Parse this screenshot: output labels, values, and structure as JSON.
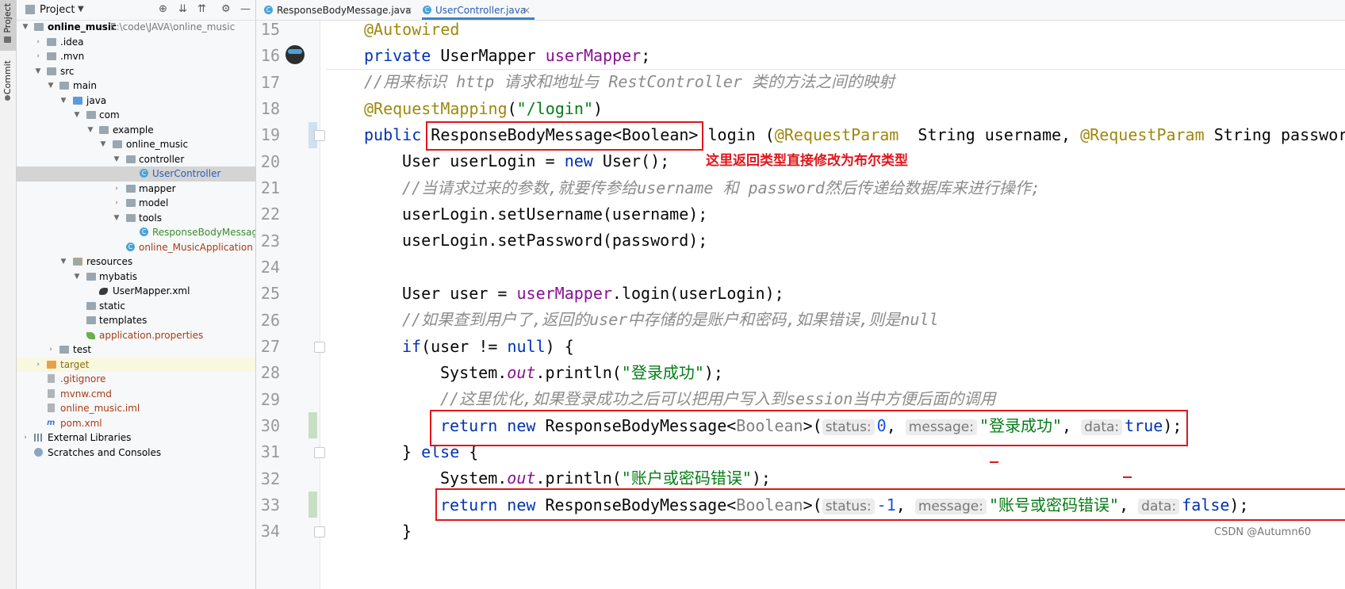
{
  "toolwindows": {
    "project_tab": "Project",
    "commit_tab": "Commit"
  },
  "project_panel": {
    "title": "Project",
    "tree": [
      {
        "label": "online_music",
        "path": "E:\\code\\JAVA\\online_music"
      },
      {
        "label": ".idea"
      },
      {
        "label": ".mvn"
      },
      {
        "label": "src"
      },
      {
        "label": "main"
      },
      {
        "label": "java"
      },
      {
        "label": "com"
      },
      {
        "label": "example"
      },
      {
        "label": "online_music"
      },
      {
        "label": "controller"
      },
      {
        "label": "UserController"
      },
      {
        "label": "mapper"
      },
      {
        "label": "model"
      },
      {
        "label": "tools"
      },
      {
        "label": "ResponseBodyMessage"
      },
      {
        "label": "online_MusicApplication"
      },
      {
        "label": "resources"
      },
      {
        "label": "mybatis"
      },
      {
        "label": "UserMapper.xml"
      },
      {
        "label": "static"
      },
      {
        "label": "templates"
      },
      {
        "label": "application.properties"
      },
      {
        "label": "test"
      },
      {
        "label": "target"
      },
      {
        "label": ".gitignore"
      },
      {
        "label": "mvnw.cmd"
      },
      {
        "label": "online_music.iml"
      },
      {
        "label": "pom.xml"
      },
      {
        "label": "External Libraries"
      },
      {
        "label": "Scratches and Consoles"
      }
    ]
  },
  "editor_tabs": [
    {
      "label": "ResponseBodyMessage.java",
      "close": "×",
      "active": false
    },
    {
      "label": "UserController.java",
      "close": "×",
      "active": true
    }
  ],
  "line_numbers": [
    "15",
    "16",
    "17",
    "18",
    "19",
    "20",
    "21",
    "22",
    "23",
    "24",
    "25",
    "26",
    "27",
    "28",
    "29",
    "30",
    "31",
    "32",
    "33",
    "34"
  ],
  "code": {
    "l15": "@Autowired",
    "l16_kw": "private",
    "l16_type": " UserMapper ",
    "l16_field": "userMapper",
    "l16_end": ";",
    "l17": "//用来标识 http 请求和地址与 RestController 类的方法之间的映射",
    "l18_ann": "@RequestMapping",
    "l18_open": "(",
    "l18_str": "\"/login\"",
    "l18_close": ")",
    "l19_kw": "public",
    "l19_type": "ResponseBodyMessage<Boolean>",
    "l19_name": " login (",
    "l19_ann1": "@RequestParam",
    "l19_p1": "  String username, ",
    "l19_ann2": "@RequestParam",
    "l19_p2": " String password) {",
    "l20_a": "User userLogin = ",
    "l20_kw": "new",
    "l20_b": " User();",
    "l21": "//当请求过来的参数,就要传参给username 和 password然后传递给数据库来进行操作;",
    "l22": "userLogin.setUsername(username);",
    "l23": "userLogin.setPassword(password);",
    "l25_a": "User user = ",
    "l25_field": "userMapper",
    "l25_b": ".login(userLogin);",
    "l26": "//如果查到用户了,返回的user中存储的是账户和密码,如果错误,则是null",
    "l27_kw": "if",
    "l27_a": "(user != ",
    "l27_kw2": "null",
    "l27_b": ") {",
    "l28_a": "System.",
    "l28_st": "out",
    "l28_b": ".println(",
    "l28_str": "\"登录成功\"",
    "l28_c": ");",
    "l29": "//这里优化,如果登录成功之后可以把用户写入到session当中方便后面的调用",
    "l30_kw1": "return",
    "l30_kw2": "new",
    "l30_type": " ResponseBodyMessage<",
    "l30_gen": "Boolean",
    "l30_open": ">(",
    "l30_h1": "status:",
    "l30_v1": "0",
    "l30_sep1": ", ",
    "l30_h2": "message:",
    "l30_v2": "\"登录成功\"",
    "l30_sep2": ", ",
    "l30_h3": "data:",
    "l30_v3": "true",
    "l30_end": ");",
    "l31_a": "} ",
    "l31_kw": "else",
    "l31_b": " {",
    "l32_a": "System.",
    "l32_st": "out",
    "l32_b": ".println(",
    "l32_str": "\"账户或密码错误\"",
    "l32_c": ");",
    "l33_kw1": "return",
    "l33_kw2": "new",
    "l33_type": " ResponseBodyMessage<",
    "l33_gen": "Boolean",
    "l33_open": ">(",
    "l33_h1": "status:",
    "l33_v1": "-1",
    "l33_sep1": ", ",
    "l33_h2": "message:",
    "l33_v2": "\"账号或密码错误\"",
    "l33_sep2": ", ",
    "l33_h3": "data:",
    "l33_v3": "false",
    "l33_end": ");",
    "l34": "}"
  },
  "annotation": {
    "text": "这里返回类型直接修改为布尔类型",
    "color": "#e0161c"
  },
  "watermark": "CSDN @Autumn60"
}
